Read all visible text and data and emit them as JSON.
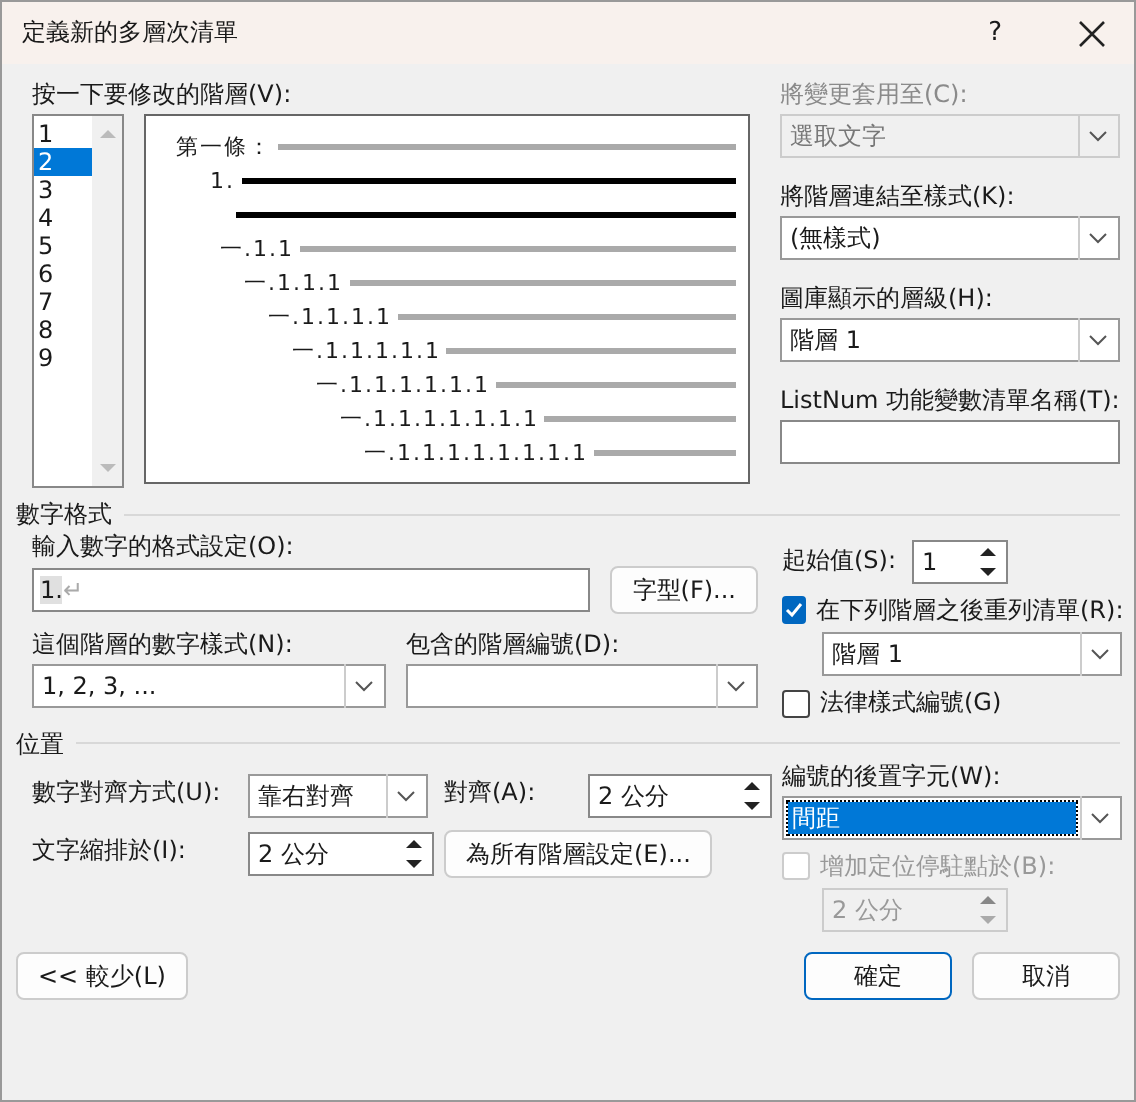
{
  "window": {
    "title": "定義新的多層次清單",
    "help": "?"
  },
  "level_picker": {
    "label": "按一下要修改的階層(V):",
    "levels": [
      {
        "label": "1",
        "selected": false
      },
      {
        "label": "2",
        "selected": true
      },
      {
        "label": "3",
        "selected": false
      },
      {
        "label": "4",
        "selected": false
      },
      {
        "label": "5",
        "selected": false
      },
      {
        "label": "6",
        "selected": false
      },
      {
        "label": "7",
        "selected": false
      },
      {
        "label": "8",
        "selected": false
      },
      {
        "label": "9",
        "selected": false
      }
    ]
  },
  "preview": {
    "lines": [
      {
        "kind": "caption",
        "text": "第一條："
      },
      {
        "kind": "current",
        "text": "1."
      },
      {
        "kind": "current_rule"
      },
      {
        "kind": "sub",
        "text": "一.1.1"
      },
      {
        "kind": "sub",
        "text": "一.1.1.1"
      },
      {
        "kind": "sub",
        "text": "一.1.1.1.1"
      },
      {
        "kind": "sub",
        "text": "一.1.1.1.1.1"
      },
      {
        "kind": "sub",
        "text": "一.1.1.1.1.1.1"
      },
      {
        "kind": "sub",
        "text": "一.1.1.1.1.1.1.1"
      },
      {
        "kind": "sub",
        "text": "一.1.1.1.1.1.1.1.1"
      }
    ]
  },
  "apply_to": {
    "label": "將變更套用至(C):",
    "value": "選取文字",
    "disabled": true
  },
  "link_style": {
    "label": "將階層連結至樣式(K):",
    "value": "(無樣式)",
    "disabled": false
  },
  "gallery_level": {
    "label": "圖庫顯示的層級(H):",
    "value": "階層 1",
    "disabled": false
  },
  "listnum_name": {
    "label": "ListNum 功能變數清單名稱(T):"
  },
  "number_format": {
    "title": "數字格式",
    "format_label": "輸入數字的格式設定(O):",
    "format_value": "1.",
    "paragraph_mark": "↵",
    "font_button": "字型(F)...",
    "style_label": "這個階層的數字樣式(N):",
    "style_value": "1, 2, 3, ...",
    "include_label": "包含的階層編號(D):",
    "start_label": "起始值(S):",
    "start_value": "1",
    "restart": {
      "label": "在下列階層之後重列清單(R):",
      "checked": true,
      "disabled": false
    },
    "restart_value": "階層 1",
    "legal": {
      "label": "法律樣式編號(G)",
      "checked": false,
      "disabled": false
    }
  },
  "position": {
    "title": "位置",
    "align_label": "數字對齊方式(U):",
    "align_value": "靠右對齊",
    "at_label": "對齊(A):",
    "at_value": "2 公分",
    "indent_label": "文字縮排於(I):",
    "indent_value": "2 公分",
    "all_levels_button": "為所有階層設定(E)...",
    "follow_label": "編號的後置字元(W):",
    "follow_value": "間距",
    "follow_focused": true,
    "tab_stop": {
      "label": "增加定位停駐點於(B):",
      "checked": false,
      "disabled": true
    },
    "tab_value": "2 公分"
  },
  "buttons": {
    "less": "<< 較少(L)",
    "ok": "確定",
    "cancel": "取消"
  }
}
